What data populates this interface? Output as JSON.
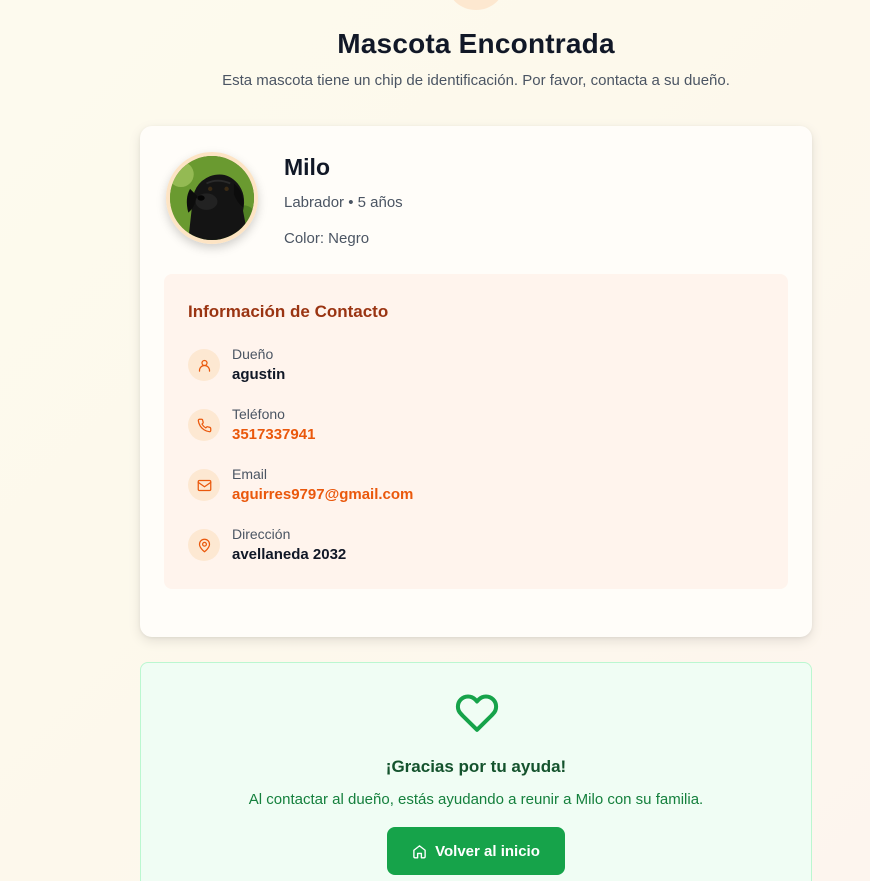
{
  "header": {
    "title": "Mascota Encontrada",
    "subtitle": "Esta mascota tiene un chip de identificación. Por favor, contacta a su dueño."
  },
  "pet": {
    "name": "Milo",
    "meta": "Labrador • 5 años",
    "color": "Color: Negro"
  },
  "contact": {
    "title": "Información de Contacto",
    "rows": [
      {
        "label": "Dueño",
        "value": "agustin",
        "icon": "user-icon"
      },
      {
        "label": "Teléfono",
        "value": "3517337941",
        "icon": "phone-icon"
      },
      {
        "label": "Email",
        "value": "aguirres9797@gmail.com",
        "icon": "mail-icon"
      },
      {
        "label": "Dirección",
        "value": "avellaneda 2032",
        "icon": "map-pin-icon"
      }
    ]
  },
  "thanks": {
    "title": "¡Gracias por tu ayuda!",
    "text": "Al contactar al dueño, estás ayudando a reunir a Milo con su familia.",
    "button_label": "Volver al inicio"
  },
  "colors": {
    "accent_orange": "#ea580c",
    "contact_title": "#9a3412",
    "green": "#16a34a"
  }
}
